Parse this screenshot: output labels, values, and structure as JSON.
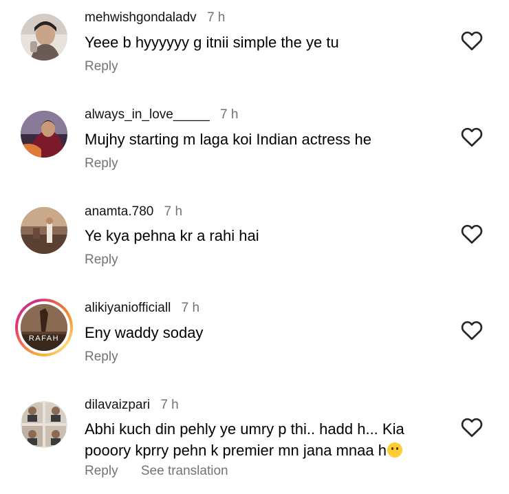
{
  "comments": [
    {
      "username": "mehwishgondaladv",
      "time": "7 h",
      "text": "Yeee b hyyyyyy g itnii simple the ye tu",
      "reply": "Reply",
      "avatar_color": "#c9b9ad"
    },
    {
      "username": "always_in_love_____",
      "time": "7 h",
      "text": "Mujhy starting m laga koi Indian actress he",
      "reply": "Reply",
      "avatar_color": "#6a3a4a"
    },
    {
      "username": "anamta.780",
      "time": "7 h",
      "text": "Ye kya pehna kr a rahi hai",
      "reply": "Reply",
      "avatar_color": "#7a5a4a"
    },
    {
      "username": "alikiyaniofficiall",
      "time": "7 h",
      "text": "Eny waddy soday",
      "reply": "Reply",
      "avatar_label": "RAFAH",
      "avatar_color": "#6e4a35"
    },
    {
      "username": "dilavaizpari",
      "time": "7 h",
      "text_line1": "Abhi kuch din pehly ye umry p thi.. hadd h... Kia",
      "text_line2": "pooory kprry pehn k premier mn jana mnaa h",
      "emoji": "thinking-face",
      "reply": "Reply",
      "see_translation": "See translation",
      "avatar_color": "#d8d0c8"
    }
  ],
  "icons": {
    "like": "heart-outline-icon"
  },
  "colors": {
    "meta_gray": "#737373",
    "text": "#000000"
  }
}
